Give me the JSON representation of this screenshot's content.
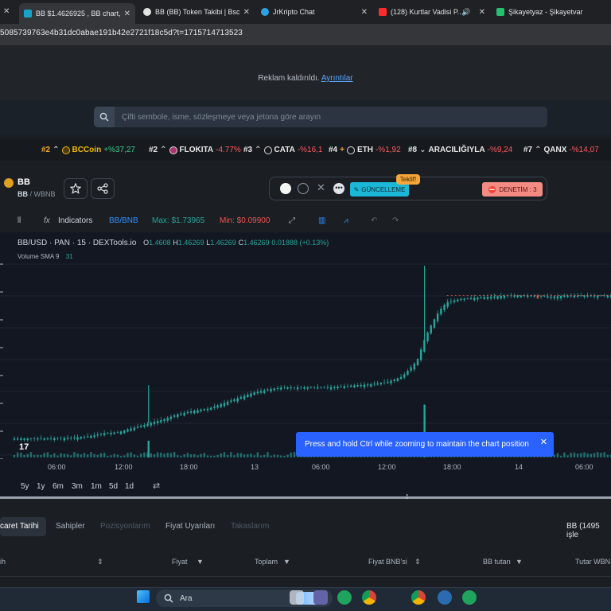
{
  "browser": {
    "tabs": [
      {
        "label": "BB $1.4626925 , BB chart,",
        "color": "#1aa3c8"
      },
      {
        "label": "BB (BB) Token Takibi | Bsc",
        "color": "#e3e3e3"
      },
      {
        "label": "JrKripto Chat",
        "color": "#2aa3e6"
      },
      {
        "label": "(128) Kurtlar Vadisi P...",
        "color": "#ff2b2b"
      },
      {
        "label": "Şikayetyaz - Şikayetvar",
        "color": "#25c06f"
      }
    ],
    "tab_close": "✕",
    "url": "5085739763e4b31dc0abae191b42e2721f18c5d?t=1715714713523"
  },
  "ad_bar": {
    "text": "Reklam kaldırıldı.",
    "link": "Ayrıntılar"
  },
  "search": {
    "placeholder": "Çifti sembole, isme, sözleşmeye veya jetona göre arayın"
  },
  "ticker": [
    {
      "rank": "#2",
      "name": "BCCoin",
      "change": "+%37,27",
      "dir": "up"
    },
    {
      "rank": "#2",
      "name": "FLOKITA",
      "change": "-4.77%",
      "dir": "down"
    },
    {
      "rank": "#3",
      "name": "CATA",
      "change": "-%16,1",
      "dir": "down"
    },
    {
      "rank": "#4",
      "name": "ETH",
      "change": "-%1,92",
      "dir": "down"
    },
    {
      "rank": "#8",
      "name": "ARACILIĞIYLA",
      "change": "-%9,24",
      "dir": "down"
    },
    {
      "rank": "#7",
      "name": "QANX",
      "change": "-%14,07",
      "dir": "down"
    }
  ],
  "pair": {
    "name": "BB",
    "base": "BB",
    "quote": "WBNB"
  },
  "badges": {
    "update": "GÜNCELLEME",
    "offer": "Teklif!",
    "audit": "DENETİM : 3"
  },
  "chart_toolbar": {
    "indicators": "Indicators",
    "pair": "BB/BNB",
    "max": "Max: $1.73965",
    "min": "Min: $0.09900"
  },
  "legend": {
    "title": "BB/USD · PAN · 15 · DEXTools.io",
    "o": "O",
    "o_val": "1.4608",
    "h": "H",
    "h_val": "1.46269",
    "l": "L",
    "l_val": "1.46269",
    "c": "C",
    "c_val": "1.46269",
    "change": "0.01888 (+0.13%)",
    "volume_label": "Volume SMA 9",
    "volume_val": "31"
  },
  "tooltip": {
    "text": "Press and hold Ctrl while zooming to maintain the chart position"
  },
  "chart_data": {
    "type": "candlestick",
    "title": "BB/USD · PAN · 15 · DEXTools.io",
    "x_ticks": [
      "06:00",
      "12:00",
      "18:00",
      "13",
      "06:00",
      "12:00",
      "18:00",
      "14",
      "06:00"
    ],
    "price_trend": [
      [
        0,
        0.12
      ],
      [
        3,
        0.12
      ],
      [
        5,
        0.12
      ],
      [
        8,
        0.13
      ],
      [
        10,
        0.14
      ],
      [
        12,
        0.17
      ],
      [
        14,
        0.18
      ],
      [
        16,
        0.22
      ],
      [
        18,
        0.26
      ],
      [
        20,
        0.3
      ],
      [
        22,
        0.35
      ],
      [
        24,
        0.38
      ],
      [
        26,
        0.4
      ],
      [
        28,
        0.45
      ],
      [
        30,
        0.5
      ],
      [
        32,
        0.55
      ],
      [
        34,
        0.58
      ],
      [
        36,
        0.6
      ],
      [
        38,
        0.6
      ],
      [
        40,
        0.6
      ],
      [
        42,
        0.6
      ],
      [
        44,
        0.61
      ],
      [
        46,
        0.62
      ],
      [
        48,
        0.63
      ],
      [
        50,
        0.65
      ],
      [
        52,
        0.7
      ],
      [
        54,
        0.85
      ],
      [
        55,
        1.05
      ],
      [
        56,
        1.2
      ],
      [
        57,
        1.32
      ],
      [
        58,
        1.4
      ],
      [
        60,
        1.43
      ],
      [
        62,
        1.44
      ],
      [
        64,
        1.45
      ],
      [
        66,
        1.46
      ],
      [
        68,
        1.46
      ],
      [
        70,
        1.46
      ],
      [
        72,
        1.45
      ],
      [
        74,
        1.46
      ],
      [
        76,
        1.46
      ],
      [
        78,
        1.46
      ],
      [
        80,
        1.46
      ]
    ],
    "price_range": [
      0.099,
      1.73965
    ],
    "spikes": [
      {
        "x": 18,
        "high": 0.62
      },
      {
        "x": 55,
        "high": 1.73965
      }
    ],
    "volume_spikes": [
      {
        "x": 18,
        "v": 0.3
      },
      {
        "x": 55,
        "v": 0.95
      }
    ]
  },
  "ranges": [
    "5y",
    "1y",
    "6m",
    "3m",
    "1m",
    "5d",
    "1d"
  ],
  "lower_tabs": [
    "caret Tarihi",
    "Sahipler",
    "Pozisyonlarım",
    "Fiyat Uyarıları",
    "Takaslarım"
  ],
  "lower_right": "BB (1495 işle",
  "table_headers": [
    "ih",
    "Fiyat",
    "Toplam",
    "Fiyat BNB'si",
    "BB tutarı",
    "Tutar WBN"
  ],
  "taskbar": {
    "search": "Ara"
  }
}
